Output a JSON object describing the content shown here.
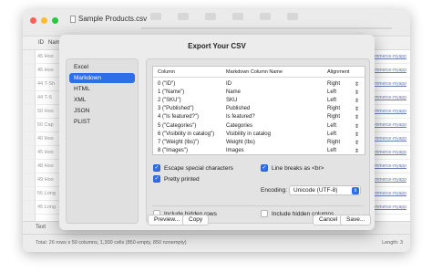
{
  "window": {
    "title": "Sample Products.csv"
  },
  "grid": {
    "header_cells": [
      "ID",
      "Nam"
    ],
    "row_ids": [
      "45 Hoo",
      "45 Hoo",
      "44 T-Sh",
      "44 T-S",
      "50 Hoo",
      "50 Cap",
      "40 Hoo",
      "45 Hoo",
      "48 Hoo",
      "49 Hoo",
      "56 Long",
      "45 Long"
    ],
    "link_text": "woocommerce-myapp",
    "tab_label": "Text"
  },
  "status": {
    "left": "Total: 26 rows x 50 columns, 1,300 cells (850 empty, 850 nonempty)",
    "right": "Length: 3"
  },
  "dialog": {
    "title": "Export Your CSV",
    "formats": [
      "Excel",
      "Markdown",
      "HTML",
      "XML",
      "JSON",
      "PLIST"
    ],
    "selected_format": "Markdown",
    "columns": {
      "headers": [
        "Column",
        "Markdown Column Name",
        "Alignment"
      ],
      "rows": [
        [
          "0 (\"ID\")",
          "ID",
          "Right"
        ],
        [
          "1 (\"Name\")",
          "Name",
          "Left"
        ],
        [
          "2 (\"SKU\")",
          "SKU",
          "Left"
        ],
        [
          "3 (\"Published\")",
          "Published",
          "Right"
        ],
        [
          "4 (\"Is featured?\")",
          "Is featured?",
          "Right"
        ],
        [
          "5 (\"Categories\")",
          "Categories",
          "Left"
        ],
        [
          "6 (\"Visibility in catalog\")",
          "Visibility in catalog",
          "Left"
        ],
        [
          "7 (\"Weight (lbs)\")",
          "Weight (lbs)",
          "Right"
        ],
        [
          "8 (\"Images\")",
          "Images",
          "Left"
        ]
      ]
    },
    "options": {
      "escape": "Escape special characters",
      "line_breaks": "Line breaks as <br>",
      "pretty": "Pretty printed",
      "encoding_label": "Encoding:",
      "encoding_value": "Unicode (UTF-8)",
      "hidden_rows": "Include hidden rows",
      "hidden_columns": "Include hidden columns"
    },
    "buttons": {
      "preview": "Preview...",
      "copy": "Copy",
      "cancel": "Cancel",
      "save": "Save..."
    }
  },
  "colors": {
    "accent": "#2f6ee8",
    "close": "#ff5f57",
    "minimize": "#febc2e",
    "zoom": "#28c840"
  },
  "icons": [
    "document-icon",
    "chevron-updown-icon",
    "checkmark-icon"
  ]
}
